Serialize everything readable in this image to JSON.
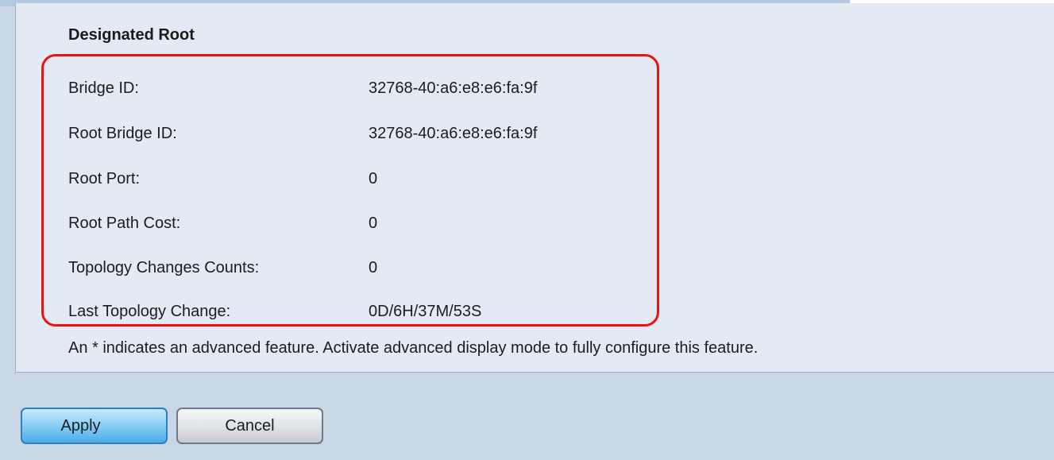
{
  "section": {
    "title": "Designated Root"
  },
  "fields": [
    {
      "label": "Bridge ID:",
      "value": "32768-40:a6:e8:e6:fa:9f"
    },
    {
      "label": "Root Bridge ID:",
      "value": "32768-40:a6:e8:e6:fa:9f"
    },
    {
      "label": "Root Port:",
      "value": "0"
    },
    {
      "label": "Root Path Cost:",
      "value": "0"
    },
    {
      "label": "Topology Changes Counts:",
      "value": "0"
    },
    {
      "label": "Last Topology Change:",
      "value": "0D/6H/37M/53S"
    }
  ],
  "note": "An * indicates an advanced feature. Activate advanced display mode to fully configure this feature.",
  "buttons": {
    "apply_label": "Apply",
    "cancel_label": "Cancel"
  },
  "colors": {
    "highlight": "#ee1111",
    "panel_background": "#e3eaf3",
    "page_background": "#c9d6e6",
    "apply_button": "#8fd0f6"
  }
}
